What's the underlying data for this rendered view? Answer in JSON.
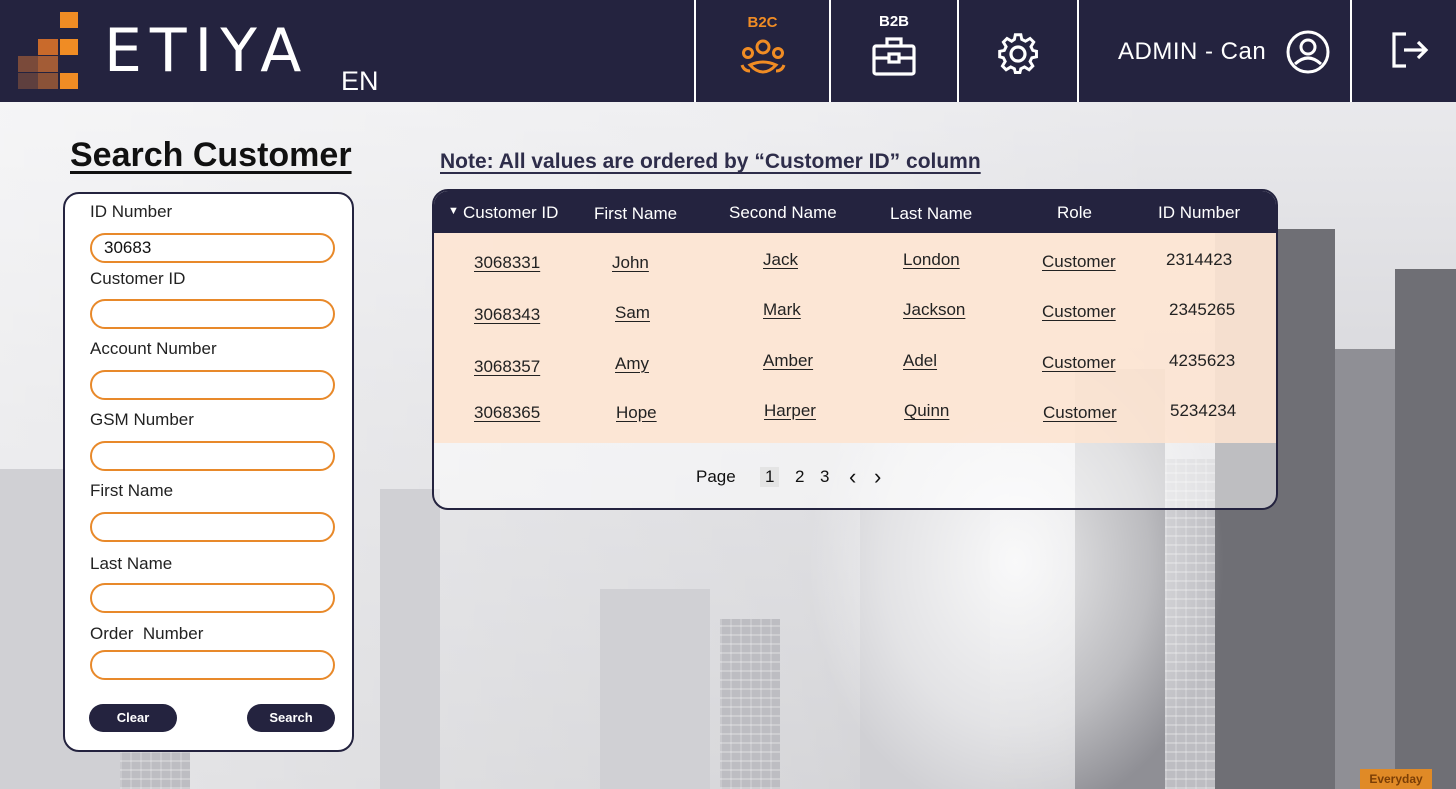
{
  "header": {
    "brand": "ETIYA",
    "language": "EN",
    "nav": [
      {
        "label": "B2C",
        "icon": "people-group-icon",
        "active": true
      },
      {
        "label": "B2B",
        "icon": "briefcase-icon",
        "active": false
      }
    ],
    "settings_icon": "gear-icon",
    "user_label": "ADMIN - Can",
    "user_icon": "user-circle-icon",
    "logout_icon": "logout-icon",
    "colors": {
      "bar": "#24233f",
      "accent": "#e8892a"
    }
  },
  "search": {
    "title": "Search Customer",
    "fields": [
      {
        "label": "ID Number",
        "value": "30683"
      },
      {
        "label": "Customer ID",
        "value": ""
      },
      {
        "label": "Account Number",
        "value": ""
      },
      {
        "label": "GSM Number",
        "value": ""
      },
      {
        "label": "First Name",
        "value": ""
      },
      {
        "label": "Last Name",
        "value": ""
      },
      {
        "label": "Order  Number",
        "value": ""
      }
    ],
    "clear_label": "Clear",
    "search_label": "Search"
  },
  "results": {
    "note": "Note: All values are ordered by “Customer ID” column",
    "columns": [
      "Customer ID",
      "First Name",
      "Second Name",
      "Last Name",
      "Role",
      "ID Number"
    ],
    "rows": [
      [
        "3068331",
        "John",
        "Jack",
        "London",
        "Customer",
        "2314423"
      ],
      [
        "3068343",
        "Sam",
        "Mark",
        "Jackson",
        "Customer",
        "2345265"
      ],
      [
        "3068357",
        "Amy",
        "Amber",
        "Adel",
        "Customer",
        "4235623"
      ],
      [
        "3068365",
        "Hope",
        "Harper",
        "Quinn",
        "Customer",
        "5234234"
      ]
    ],
    "pager": {
      "label": "Page",
      "pages": [
        "1",
        "2",
        "3"
      ],
      "current": "1",
      "prev": "‹",
      "next": "›"
    }
  },
  "footer_badge": "Everyday"
}
